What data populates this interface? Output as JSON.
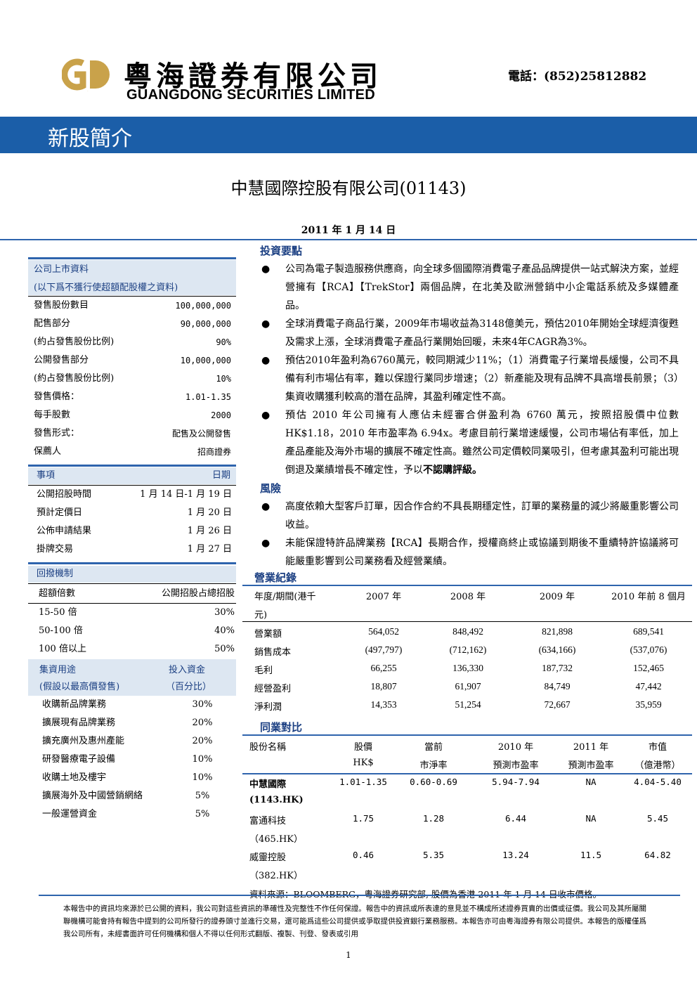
{
  "header": {
    "logo_letters": "GD",
    "logo_cn": "粵海證券有限公司",
    "logo_en": "GUANGDONG SECURITIES LIMITED",
    "phone": "電話：(852)25812882",
    "banner_title": "新股簡介",
    "colors": {
      "brand_blue": "#1b5ea8",
      "logo_gold": "#c9a24a",
      "table_header": "#dde7f2"
    }
  },
  "title": "中慧國際控股有限公司(01143)",
  "date": "2011 年 1 月 14 日",
  "listing": {
    "header1": "公司上市資料",
    "header2": "(以下爲不獲行使超額配股權之資料)",
    "rows": [
      {
        "label": "發售股份數目",
        "value": "100,000,000"
      },
      {
        "label": "配售部分",
        "value": "90,000,000"
      },
      {
        "label": "(約占發售股份比例)",
        "value": "90%"
      },
      {
        "label": "公開發售部分",
        "value": "10,000,000"
      },
      {
        "label": "(約占發售股份比例)",
        "value": "10%"
      },
      {
        "label": "發售價格：",
        "value": "1.01-1.35"
      },
      {
        "label": "每手股數",
        "value": "2000"
      },
      {
        "label": "發售形式：",
        "value": "配售及公開發售"
      },
      {
        "label": "保薦人",
        "value": "招商證券"
      }
    ]
  },
  "schedule": {
    "head_item": "事項",
    "head_date": "日期",
    "rows": [
      {
        "label": "公開招股時間",
        "value": "1 月 14 日-1 月 19 日"
      },
      {
        "label": "預計定價日",
        "value": "1 月 20 日"
      },
      {
        "label": "公佈申請結果",
        "value": "1 月 26 日"
      },
      {
        "label": "掛牌交易",
        "value": "1 月 27 日"
      }
    ]
  },
  "clawback": {
    "title": "回撥機制",
    "head_left": "超額倍數",
    "head_right": "公開招股占總招股",
    "rows": [
      {
        "label": "15-50 倍",
        "value": "30%"
      },
      {
        "label": "50-100 倍",
        "value": "40%"
      },
      {
        "label": "100 倍以上",
        "value": "50%"
      }
    ]
  },
  "use_of_proceeds": {
    "head_left1": "集資用途",
    "head_right1": "投入資金",
    "head_left2": "(假設以最高價發售)",
    "head_right2": "（百分比）",
    "rows": [
      {
        "label": "收購新品牌業務",
        "value": "30%"
      },
      {
        "label": "擴展現有品牌業務",
        "value": "20%"
      },
      {
        "label": "擴充廣州及惠州產能",
        "value": "20%"
      },
      {
        "label": "研發醫療電子設備",
        "value": "10%"
      },
      {
        "label": "收購土地及樓宇",
        "value": "10%"
      },
      {
        "label": "擴展海外及中國營銷網絡",
        "value": "5%"
      },
      {
        "label": "一般運營資金",
        "value": "5%"
      }
    ]
  },
  "highlights": {
    "title": "投資要點",
    "bullet": "●",
    "items": [
      "公司為電子製造服務供應商，向全球多個國際消費電子產品品牌提供一站式解決方案，並經營擁有【RCA】【TrekStor】兩個品牌，在北美及歐洲營銷中小企電話系統及多媒體產品。",
      "全球消費電子商品行業，2009年市場收益為3148億美元，預估2010年開始全球經濟復甦及需求上漲，全球消費電子產品行業開始回暖，未來4年CAGR為3%。",
      "預估2010年盈利為6760萬元，較同期減少11%；（1）消費電子行業增長緩慢，公司不具備有利市場佔有率，難以保證行業同步增速；（2）新產能及現有品牌不具高增長前景；（3）集資收購獲利較高的潛在品牌，其盈利確定性不高。",
      "預估 2010 年公司擁有人應佔未經審合併盈利為 6760 萬元，按照招股價中位數HK$1.18，2010 年市盈率為 6.94x。考慮目前行業增速緩慢，公司市場佔有率低，加上產品產能及海外市場的擴展不確定性高。雖然公司定價較同業吸引，但考慮其盈利可能出現倒退及業績增長不確定性，予以"
    ],
    "rating": "不認購評級。"
  },
  "risks": {
    "title": "風險",
    "items": [
      "高度依賴大型客戶訂單，因合作合約不具長期穩定性，訂單的業務量的減少將嚴重影響公司收益。",
      "未能保證特許品牌業務【RCA】長期合作，授權商終止或協議到期後不重續特許協議將可能嚴重影響到公司業務看及經營業績。"
    ]
  },
  "results": {
    "title": "營業紀錄",
    "period_label_1": "年度/期間(港千",
    "period_label_2": "元)",
    "columns": [
      "2007 年",
      "2008 年",
      "2009 年",
      "2010 年前 8 個月"
    ],
    "rows": [
      {
        "label": "營業額",
        "values": [
          "564,052",
          "848,492",
          "821,898",
          "689,541"
        ]
      },
      {
        "label": "銷售成本",
        "values": [
          "(497,797)",
          "(712,162)",
          "(634,166)",
          "(537,076)"
        ]
      },
      {
        "label": "毛利",
        "values": [
          "66,255",
          "136,330",
          "187,732",
          "152,465"
        ]
      },
      {
        "label": "經營盈利",
        "values": [
          "18,807",
          "61,907",
          "84,749",
          "47,442"
        ]
      },
      {
        "label": "淨利潤",
        "values": [
          "14,353",
          "51,254",
          "72,667",
          "35,959"
        ]
      }
    ]
  },
  "peers": {
    "title": "同業對比",
    "head1": [
      "股份名稱",
      "股價",
      "當前",
      "2010 年",
      "2011 年",
      "市值"
    ],
    "head2": [
      "",
      "HK$",
      "市淨率",
      "預測市盈率",
      "預測市盈率",
      "（億港幣）"
    ],
    "rows": [
      {
        "name": "中慧國際",
        "code": "(1143.HK)",
        "values": [
          "1.01-1.35",
          "0.60-0.69",
          "5.94-7.94",
          "NA",
          "4.04-5.40"
        ]
      },
      {
        "name": "富通科技",
        "code": "（465.HK）",
        "values": [
          "1.75",
          "1.28",
          "6.44",
          "NA",
          "5.45"
        ]
      },
      {
        "name": "威靈控股",
        "code": "（382.HK）",
        "values": [
          "0.46",
          "5.35",
          "13.24",
          "11.5",
          "64.82"
        ]
      }
    ],
    "source": "資料來源：BLOOMBERG，粵海證券研究部, 股價為香港 2011 年 1 月 14 日收市價格。"
  },
  "footer": {
    "disclaimer": "本報告中的資訊均來源於已公開的資料，我公司對這些資訊的準確性及完整性不作任何保證。報告中的資訊或所表達的意見並不構成所述證券買賣的出價或征價。我公司及其所屬關聯機構可能會持有報告中提到的公司所發行的證券頭寸並進行交易，還可能爲這些公司提供或爭取提供投資銀行業務服務。本報告亦可由粵海證券有限公司提供。本報告的版權僅爲我公司所有，未經書面許可任何機構和個人不得以任何形式翻版、複製、刊登、發表或引用",
    "page": "1"
  }
}
